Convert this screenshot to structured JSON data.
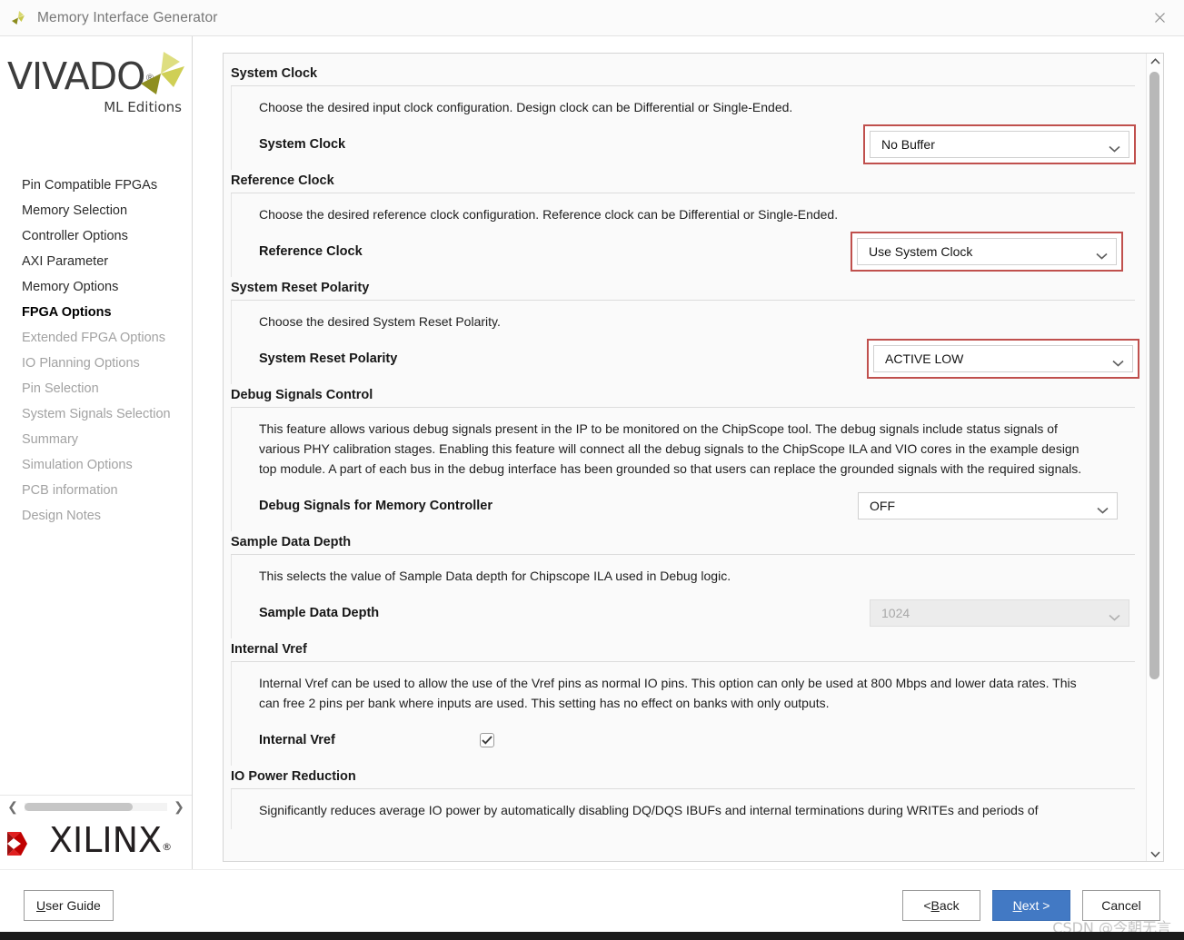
{
  "window": {
    "title": "Memory Interface Generator",
    "title_icon": "vivado-pinwheel-icon",
    "close_icon": "close-icon"
  },
  "sidebar": {
    "logo": {
      "wordmark": "VIVADO",
      "registered": "®",
      "subtitle": "ML Editions"
    },
    "items": [
      {
        "label": "Pin Compatible FPGAs",
        "state": "enabled"
      },
      {
        "label": "Memory Selection",
        "state": "enabled"
      },
      {
        "label": "Controller Options",
        "state": "enabled"
      },
      {
        "label": "AXI Parameter",
        "state": "enabled"
      },
      {
        "label": "Memory Options",
        "state": "enabled"
      },
      {
        "label": "FPGA Options",
        "state": "active"
      },
      {
        "label": "Extended FPGA Options",
        "state": "disabled"
      },
      {
        "label": "IO Planning Options",
        "state": "disabled"
      },
      {
        "label": "Pin Selection",
        "state": "disabled"
      },
      {
        "label": "System Signals Selection",
        "state": "disabled"
      },
      {
        "label": "Summary",
        "state": "disabled"
      },
      {
        "label": "Simulation Options",
        "state": "disabled"
      },
      {
        "label": "PCB information",
        "state": "disabled"
      },
      {
        "label": "Design Notes",
        "state": "disabled"
      }
    ],
    "hscroll": {
      "left_icon": "chevron-left-icon",
      "right_icon": "chevron-right-icon"
    },
    "brand": {
      "wordmark": "XILINX",
      "registered": "®"
    }
  },
  "sections": [
    {
      "id": "system-clock",
      "header": "System Clock",
      "description": "Choose the desired input clock configuration. Design clock can be Differential or Single-Ended.",
      "field_label": "System Clock",
      "control": "combobox",
      "value": "No Buffer",
      "highlighted": true,
      "disabled": false
    },
    {
      "id": "reference-clock",
      "header": "Reference Clock",
      "description": "Choose the desired reference clock configuration. Reference clock can be Differential or Single-Ended.",
      "field_label": "Reference Clock",
      "control": "combobox",
      "value": "Use System Clock",
      "highlighted": true,
      "disabled": false
    },
    {
      "id": "system-reset-polarity",
      "header": "System Reset Polarity",
      "description": "Choose the desired System Reset Polarity.",
      "field_label": "System Reset Polarity",
      "control": "combobox",
      "value": "ACTIVE LOW",
      "highlighted": true,
      "disabled": false
    },
    {
      "id": "debug-signals-control",
      "header": "Debug Signals Control",
      "description": "This feature allows various debug signals present in the IP to be monitored on the ChipScope tool. The debug signals include status signals of various PHY calibration stages. Enabling this feature will connect all the debug signals to the ChipScope ILA and VIO cores in the example design top module. A part of each bus in the debug interface has been grounded so that users can replace the grounded signals with the required signals.",
      "field_label": "Debug Signals for Memory Controller",
      "control": "combobox",
      "value": "OFF",
      "highlighted": false,
      "disabled": false
    },
    {
      "id": "sample-data-depth",
      "header": "Sample Data Depth",
      "description": "This selects the value of Sample Data depth for Chipscope ILA used in Debug logic.",
      "field_label": "Sample Data Depth",
      "control": "combobox",
      "value": "1024",
      "highlighted": false,
      "disabled": true
    },
    {
      "id": "internal-vref",
      "header": "Internal Vref",
      "description": "Internal Vref can be used to allow the use of the Vref pins as normal IO pins. This option can only be used at 800 Mbps and lower data rates. This can free 2 pins per bank where inputs are used. This setting has no effect on banks with only outputs.",
      "field_label": "Internal Vref",
      "control": "checkbox",
      "value": "checked",
      "highlighted": false,
      "disabled": false
    },
    {
      "id": "io-power-reduction",
      "header": "IO Power Reduction",
      "description": "Significantly reduces average IO power by automatically disabling DQ/DQS IBUFs and internal terminations during WRITEs and periods of",
      "field_label": "",
      "control": "none",
      "value": "",
      "highlighted": false,
      "disabled": false
    }
  ],
  "scrollbar": {
    "up_icon": "chevron-up-icon",
    "down_icon": "chevron-down-icon",
    "thumb_percent": 78
  },
  "footer": {
    "user_guide": {
      "pre": "",
      "mnemonic": "U",
      "post": "ser Guide"
    },
    "back": {
      "pre": "< ",
      "mnemonic": "B",
      "post": "ack"
    },
    "next": {
      "pre": "",
      "mnemonic": "N",
      "post": "ext >"
    },
    "cancel": {
      "pre": "Cancel",
      "mnemonic": "",
      "post": ""
    }
  },
  "watermark": "CSDN @今朝无言",
  "colors": {
    "accent": "#4279c4",
    "highlight_border": "#c0504d",
    "xilinx_red": "#cc0000",
    "vivado_olive": "#b5b430"
  }
}
